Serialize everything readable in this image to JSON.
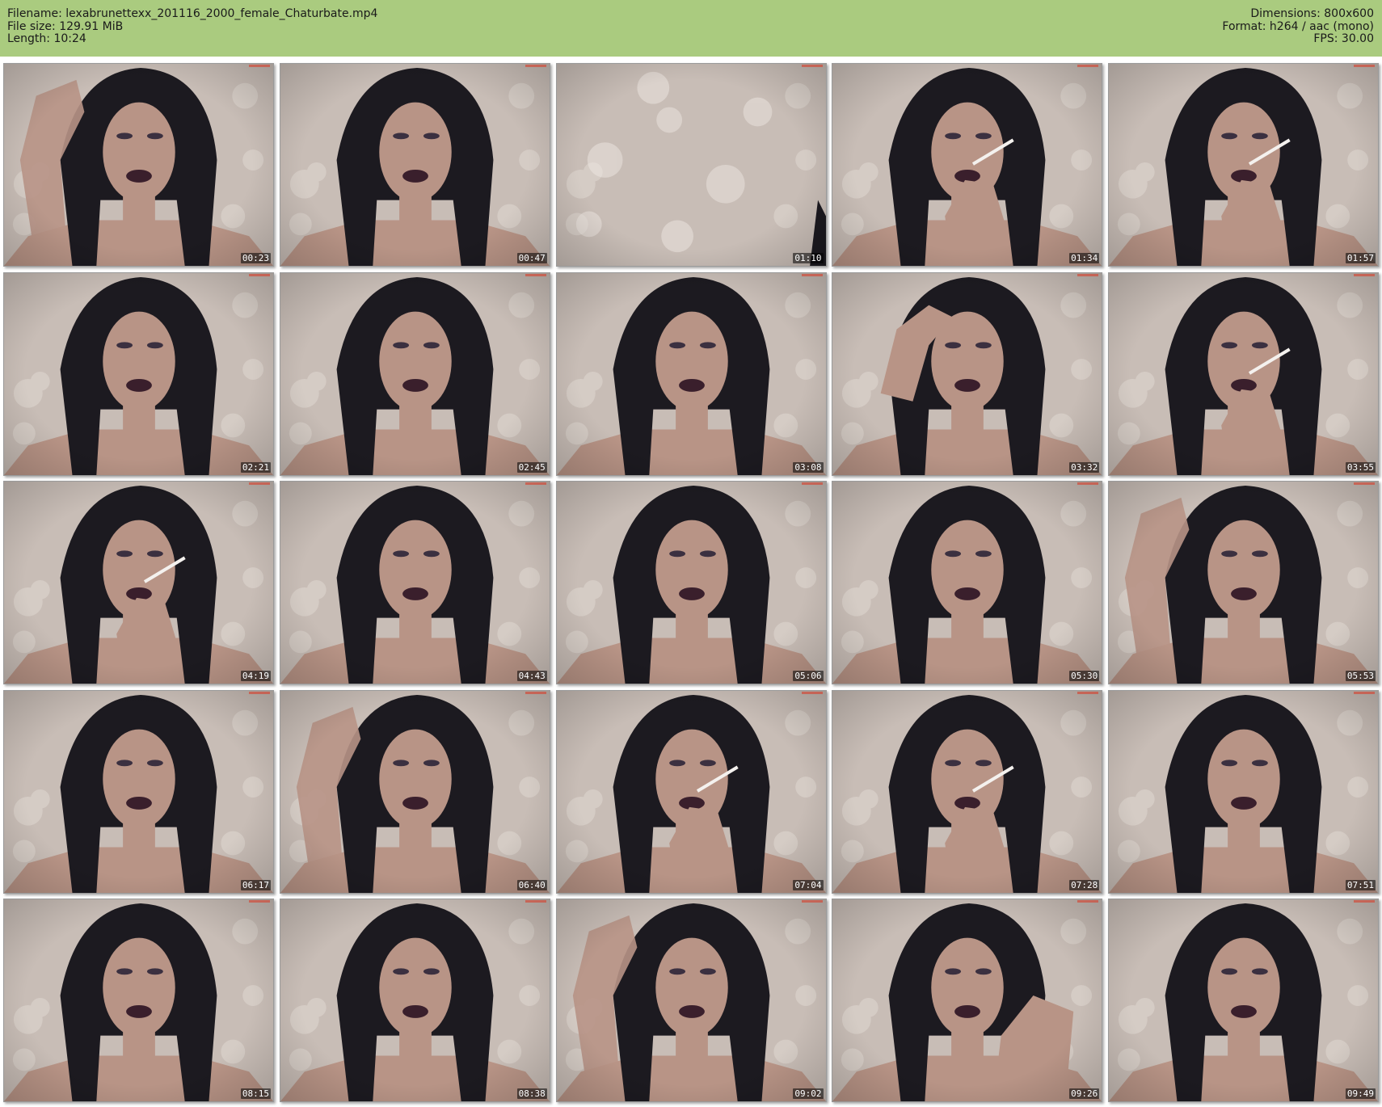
{
  "header": {
    "filename_line": "Filename: lexabrunettexx_201116_2000_female_Chaturbate.mp4",
    "filesize_line": "File size: 129.91 MiB",
    "length_line": "Length: 10:24",
    "dimensions_line": "Dimensions: 800x600",
    "format_line": "Format: h264 / aac (mono)",
    "fps_line": "FPS: 30.00"
  },
  "colors": {
    "header_bg": "#aacb7f",
    "wallpaper": "#c8bdb6",
    "hair": "#1c1a20",
    "skin": "#b89486",
    "lips": "#3a1f2c"
  },
  "thumbnails": [
    {
      "time": "00:23",
      "scene": "arms-up"
    },
    {
      "time": "00:47",
      "scene": "portrait"
    },
    {
      "time": "01:10",
      "scene": "empty-wall"
    },
    {
      "time": "01:34",
      "scene": "smoking"
    },
    {
      "time": "01:57",
      "scene": "smoking"
    },
    {
      "time": "02:21",
      "scene": "portrait"
    },
    {
      "time": "02:45",
      "scene": "portrait"
    },
    {
      "time": "03:08",
      "scene": "portrait"
    },
    {
      "time": "03:32",
      "scene": "hand-on-head"
    },
    {
      "time": "03:55",
      "scene": "smoking"
    },
    {
      "time": "04:19",
      "scene": "smoking"
    },
    {
      "time": "04:43",
      "scene": "portrait"
    },
    {
      "time": "05:06",
      "scene": "portrait"
    },
    {
      "time": "05:30",
      "scene": "portrait"
    },
    {
      "time": "05:53",
      "scene": "arms-up"
    },
    {
      "time": "06:17",
      "scene": "portrait"
    },
    {
      "time": "06:40",
      "scene": "arms-up"
    },
    {
      "time": "07:04",
      "scene": "smoking"
    },
    {
      "time": "07:28",
      "scene": "smoking"
    },
    {
      "time": "07:51",
      "scene": "portrait"
    },
    {
      "time": "08:15",
      "scene": "portrait"
    },
    {
      "time": "08:38",
      "scene": "portrait"
    },
    {
      "time": "09:02",
      "scene": "arms-up"
    },
    {
      "time": "09:26",
      "scene": "hand-on-neck"
    },
    {
      "time": "09:49",
      "scene": "portrait"
    }
  ]
}
